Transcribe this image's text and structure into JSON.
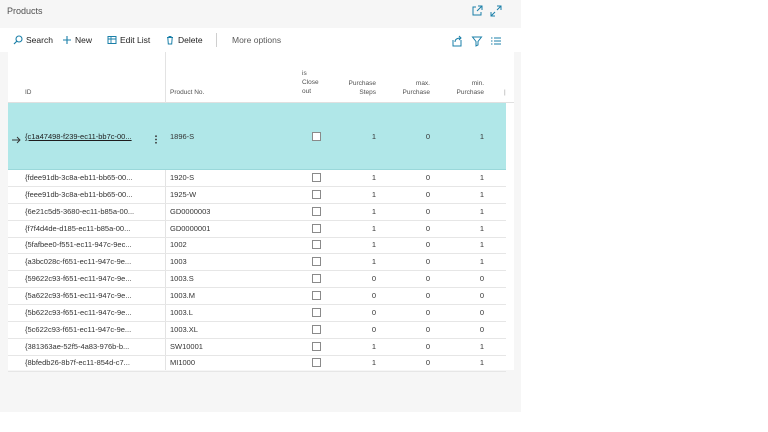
{
  "window": {
    "title": "Products"
  },
  "toolbar": {
    "search_label": "Search",
    "new_label": "New",
    "edit_list_label": "Edit List",
    "delete_label": "Delete",
    "more_label": "More options"
  },
  "columns": {
    "id": "ID",
    "product_no": "Product No.",
    "is_close_out_1": "is",
    "is_close_out_2": "Close",
    "is_close_out_3": "out",
    "purchase_steps_1": "Purchase",
    "purchase_steps_2": "Steps",
    "max_purchase_1": "max.",
    "max_purchase_2": "Purchase",
    "min_purchase_1": "min.",
    "min_purchase_2": "Purchase"
  },
  "rows": [
    {
      "id": "{c1a47498-f239-ec11-bb7c-00...",
      "product_no": "1896-S",
      "steps": "1",
      "max": "0",
      "min": "1"
    },
    {
      "id": "{fdee91db-3c8a-eb11-bb65-00...",
      "product_no": "1920-S",
      "steps": "1",
      "max": "0",
      "min": "1"
    },
    {
      "id": "{feee91db-3c8a-eb11-bb65-00...",
      "product_no": "1925-W",
      "steps": "1",
      "max": "0",
      "min": "1"
    },
    {
      "id": "{6e21c5d5-3680-ec11-b85a-00...",
      "product_no": "GD0000003",
      "steps": "1",
      "max": "0",
      "min": "1"
    },
    {
      "id": "{f7f4d4de-d185-ec11-b85a-00...",
      "product_no": "GD0000001",
      "steps": "1",
      "max": "0",
      "min": "1"
    },
    {
      "id": "{5fafbee0-f551-ec11-947c-9ec...",
      "product_no": "1002",
      "steps": "1",
      "max": "0",
      "min": "1"
    },
    {
      "id": "{a3bc028c-f651-ec11-947c-9e...",
      "product_no": "1003",
      "steps": "1",
      "max": "0",
      "min": "1"
    },
    {
      "id": "{59622c93-f651-ec11-947c-9e...",
      "product_no": "1003.S",
      "steps": "0",
      "max": "0",
      "min": "0"
    },
    {
      "id": "{5a622c93-f651-ec11-947c-9e...",
      "product_no": "1003.M",
      "steps": "0",
      "max": "0",
      "min": "0"
    },
    {
      "id": "{5b622c93-f651-ec11-947c-9e...",
      "product_no": "1003.L",
      "steps": "0",
      "max": "0",
      "min": "0"
    },
    {
      "id": "{5c622c93-f651-ec11-947c-9e...",
      "product_no": "1003.XL",
      "steps": "0",
      "max": "0",
      "min": "0"
    },
    {
      "id": "{381363ae-52f5-4a83-976b-b...",
      "product_no": "SW10001",
      "steps": "1",
      "max": "0",
      "min": "1"
    },
    {
      "id": "{8bfedb26-8b7f-ec11-854d-c7...",
      "product_no": "MI1000",
      "steps": "1",
      "max": "0",
      "min": "1"
    }
  ],
  "colors": {
    "accent": "#1a7fa8",
    "selected_row": "#b0e7e8"
  },
  "icons": [
    "open-in-new-icon",
    "expand-icon",
    "search-icon",
    "plus-icon",
    "edit-list-icon",
    "delete-icon",
    "share-icon",
    "filter-icon",
    "list-view-icon",
    "arrow-right-icon",
    "more-vertical-icon"
  ]
}
